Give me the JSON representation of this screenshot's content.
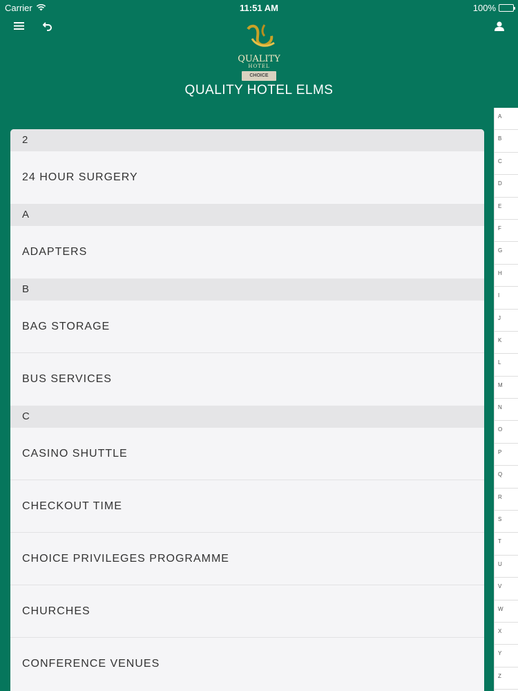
{
  "status_bar": {
    "carrier": "Carrier",
    "time": "11:51 AM",
    "battery": "100%"
  },
  "header": {
    "logo_brand": "QUALITY",
    "logo_sub": "HOTEL",
    "logo_choice": "CHOICE",
    "title": "QUALITY HOTEL ELMS"
  },
  "sections": [
    {
      "header": "2",
      "items": [
        "24 HOUR SURGERY"
      ]
    },
    {
      "header": "A",
      "items": [
        "ADAPTERS"
      ]
    },
    {
      "header": "B",
      "items": [
        "BAG STORAGE",
        "BUS SERVICES"
      ]
    },
    {
      "header": "C",
      "items": [
        "CASINO SHUTTLE",
        "CHECKOUT TIME",
        "CHOICE PRIVILEGES PROGRAMME",
        "CHURCHES",
        "CONFERENCE VENUES"
      ]
    }
  ],
  "alpha_index": [
    "A",
    "B",
    "C",
    "D",
    "E",
    "F",
    "G",
    "H",
    "I",
    "J",
    "K",
    "L",
    "M",
    "N",
    "O",
    "P",
    "Q",
    "R",
    "S",
    "T",
    "U",
    "V",
    "W",
    "X",
    "Y",
    "Z"
  ],
  "colors": {
    "background": "#06765c",
    "list_bg": "#f5f5f7",
    "section_bg": "#e5e5e7"
  }
}
